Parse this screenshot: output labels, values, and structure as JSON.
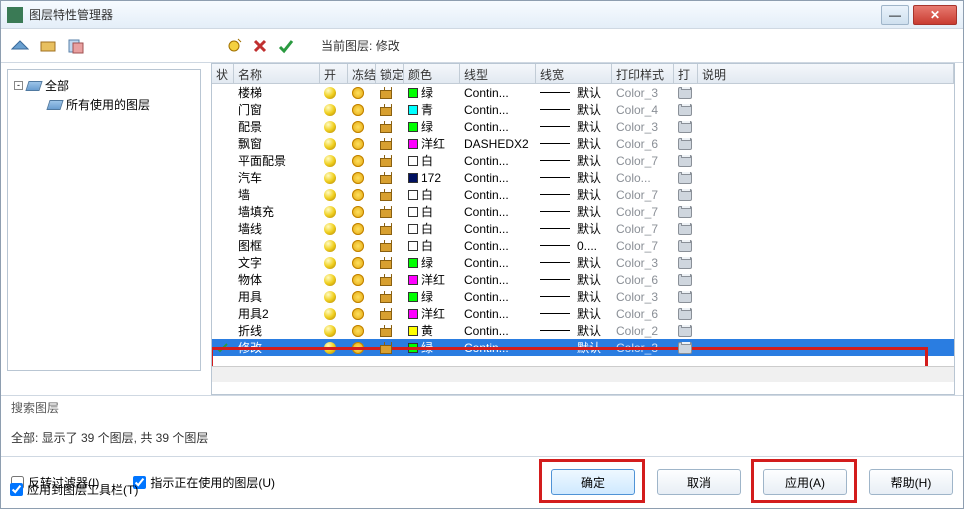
{
  "window_title": "图层特性管理器",
  "toolbar": {
    "current_layer_prefix": "当前图层:",
    "current_layer_name": "修改"
  },
  "tree": {
    "root": "全部",
    "child": "所有使用的图层"
  },
  "columns": {
    "status": "状",
    "name": "名称",
    "on": "开",
    "freeze": "冻结",
    "lock": "锁定",
    "color": "颜色",
    "linetype": "线型",
    "lineweight": "线宽",
    "plotstyle": "打印样式",
    "plot": "打",
    "desc": "说明"
  },
  "layers": [
    {
      "name": "楼梯",
      "color": "绿",
      "sw": "sw-green",
      "lt": "Contin...",
      "lw": "默认",
      "ps": "Color_3"
    },
    {
      "name": "门窗",
      "color": "青",
      "sw": "sw-cyan",
      "lt": "Contin...",
      "lw": "默认",
      "ps": "Color_4"
    },
    {
      "name": "配景",
      "color": "绿",
      "sw": "sw-green",
      "lt": "Contin...",
      "lw": "默认",
      "ps": "Color_3"
    },
    {
      "name": "飘窗",
      "color": "洋红",
      "sw": "sw-magenta",
      "lt": "DASHEDX2",
      "lw": "默认",
      "ps": "Color_6"
    },
    {
      "name": "平面配景",
      "color": "白",
      "sw": "sw-white",
      "lt": "Contin...",
      "lw": "默认",
      "ps": "Color_7"
    },
    {
      "name": "汽车",
      "color": "172",
      "sw": "sw-dark",
      "lt": "Contin...",
      "lw": "默认",
      "ps": "Colo..."
    },
    {
      "name": "墙",
      "color": "白",
      "sw": "sw-white",
      "lt": "Contin...",
      "lw": "默认",
      "ps": "Color_7"
    },
    {
      "name": "墙填充",
      "color": "白",
      "sw": "sw-white",
      "lt": "Contin...",
      "lw": "默认",
      "ps": "Color_7"
    },
    {
      "name": "墙线",
      "color": "白",
      "sw": "sw-white",
      "lt": "Contin...",
      "lw": "默认",
      "ps": "Color_7"
    },
    {
      "name": "图框",
      "color": "白",
      "sw": "sw-white",
      "lt": "Contin...",
      "lw": "0....",
      "ps": "Color_7"
    },
    {
      "name": "文字",
      "color": "绿",
      "sw": "sw-green",
      "lt": "Contin...",
      "lw": "默认",
      "ps": "Color_3"
    },
    {
      "name": "物体",
      "color": "洋红",
      "sw": "sw-magenta",
      "lt": "Contin...",
      "lw": "默认",
      "ps": "Color_6"
    },
    {
      "name": "用具",
      "color": "绿",
      "sw": "sw-green",
      "lt": "Contin...",
      "lw": "默认",
      "ps": "Color_3"
    },
    {
      "name": "用具2",
      "color": "洋红",
      "sw": "sw-magenta",
      "lt": "Contin...",
      "lw": "默认",
      "ps": "Color_6"
    },
    {
      "name": "折线",
      "color": "黄",
      "sw": "sw-yellow",
      "lt": "Contin...",
      "lw": "默认",
      "ps": "Color_2"
    },
    {
      "name": "修改",
      "color": "绿",
      "sw": "sw-green",
      "lt": "Contin...",
      "lw": "默认",
      "ps": "Color_3",
      "selected": true,
      "current": true
    }
  ],
  "search_placeholder": "搜索图层",
  "summary": "全部: 显示了 39 个图层, 共 39 个图层",
  "opts": {
    "invert": "反转过滤器(I)",
    "indicate": "指示正在使用的图层(U)",
    "applytb": "应用到图层工具栏(T)"
  },
  "buttons": {
    "ok": "确定",
    "cancel": "取消",
    "apply": "应用(A)",
    "help": "帮助(H)"
  }
}
